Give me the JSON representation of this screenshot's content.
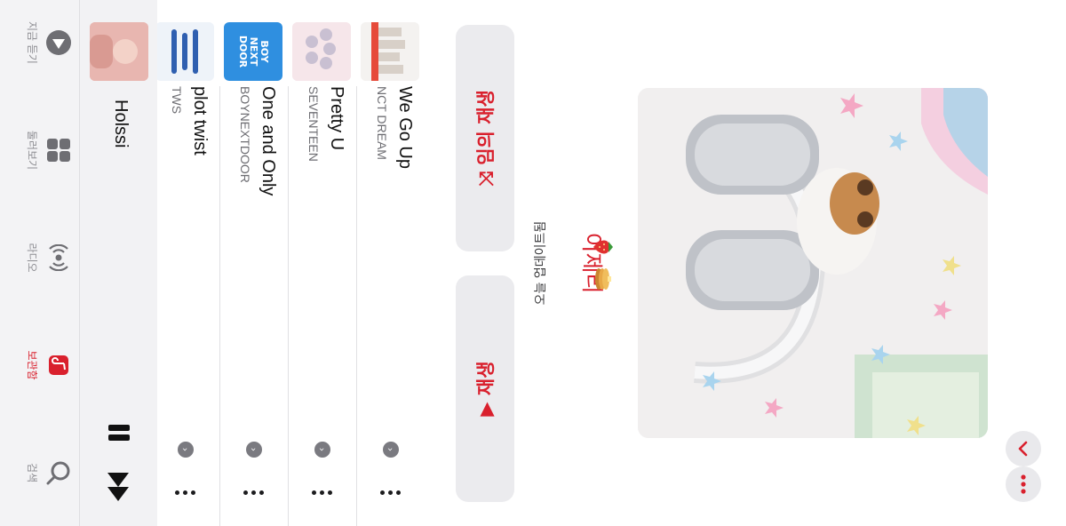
{
  "header": {
    "more_icon": "ellipsis-icon",
    "forward_icon": "chevron-right-icon",
    "collapse_icon": "chevron-down-icon"
  },
  "playlist": {
    "title": "이제리",
    "subtitle": "오늘 업데이트됨",
    "emoji": "🍓🥞",
    "artwork": "airpods-max-plush-photo"
  },
  "actions": {
    "play_label": "▶ 재생",
    "shuffle_label": "⤨ 임의 재생"
  },
  "tracks": [
    {
      "title": "We Go Up",
      "artist": "NCT DREAM",
      "art_color": "#f4f2f0"
    },
    {
      "title": "Pretty U",
      "artist": "SEVENTEEN",
      "art_color": "#f6e6ea"
    },
    {
      "title": "One and Only",
      "artist": "BOYNEXTDOOR",
      "art_color": "#2f8fe0",
      "art_text": "BOY NEXT DOOR"
    },
    {
      "title": "plot twist",
      "artist": "TWS",
      "art_color": "#eef3f9"
    }
  ],
  "mini_player": {
    "title": "Holssi",
    "art_color": "#e8b6b0"
  },
  "tabs": [
    {
      "label": "지금 듣기",
      "icon": "play-circle-icon"
    },
    {
      "label": "둘러보기",
      "icon": "grid-icon"
    },
    {
      "label": "라디오",
      "icon": "radio-icon"
    },
    {
      "label": "보관함",
      "icon": "library-icon",
      "active": true
    },
    {
      "label": "검색",
      "icon": "search-icon"
    }
  ],
  "colors": {
    "accent": "#d9202d",
    "button_bg": "#ebebee",
    "tabbar_bg": "#f3f3f5"
  }
}
